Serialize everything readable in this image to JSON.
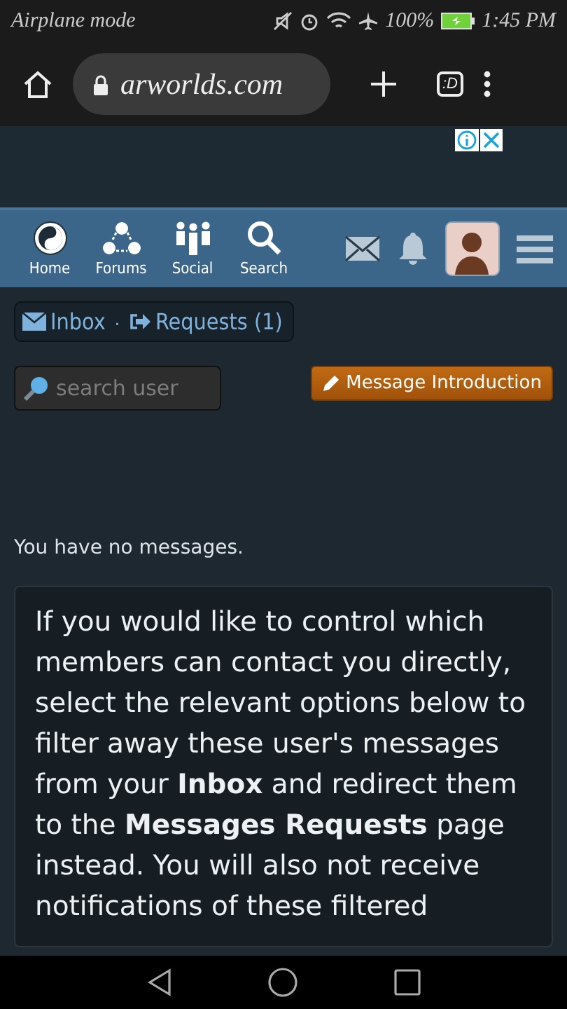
{
  "status_bar": {
    "left": "Airplane mode",
    "battery": "100%",
    "time": "1:45 PM"
  },
  "browser": {
    "url": "arworlds.com",
    "tab_count": ":D"
  },
  "site_nav": {
    "items": [
      {
        "label": "Home",
        "kind": "home"
      },
      {
        "label": "Forums",
        "kind": "forums"
      },
      {
        "label": "Social",
        "kind": "social"
      },
      {
        "label": "Search",
        "kind": "search"
      }
    ]
  },
  "message_tabs_separator": "·",
  "message_tabs": [
    {
      "label": "Inbox",
      "kind": "inbox"
    },
    {
      "label": "Requests (1)",
      "kind": "requests"
    }
  ],
  "search": {
    "placeholder": "search user"
  },
  "intro_button": "Message Introduction",
  "empty_text": "You have no messages.",
  "info_text": "If you would like to control which members can contact you directly, select the relevant options below to filter away these user's messages from your **Inbox** and redirect them to the **Messages Requests** page instead. You will also not receive notifications of these filtered"
}
